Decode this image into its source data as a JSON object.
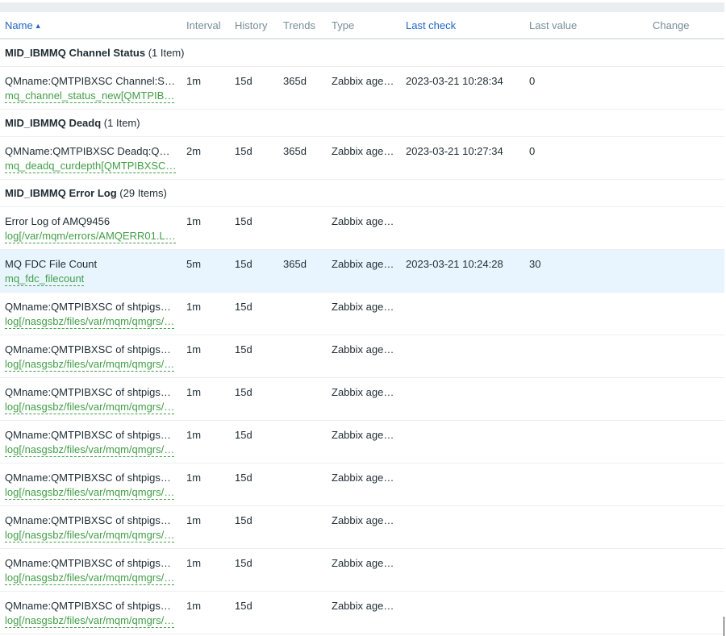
{
  "columns": {
    "name": "Name",
    "interval": "Interval",
    "history": "History",
    "trends": "Trends",
    "type": "Type",
    "last_check": "Last check",
    "last_value": "Last value",
    "change": "Change"
  },
  "sort_icon": "▲",
  "groups": [
    {
      "title": "MID_IBMMQ Channel Status",
      "count": "(1 Item)",
      "rows": [
        {
          "name": "QMname:QMTPIBXSC Channel:S…",
          "key": "mq_channel_status_new[QMTPIB…",
          "interval": "1m",
          "history": "15d",
          "trends": "365d",
          "type": "Zabbix age…",
          "last_check": "2023-03-21 10:28:34",
          "last_value": "0",
          "change": ""
        }
      ]
    },
    {
      "title": "MID_IBMMQ Deadq",
      "count": "(1 Item)",
      "rows": [
        {
          "name": "QMName:QMTPIBXSC Deadq:Q…",
          "key": "mq_deadq_curdepth[QMTPIBXSC…",
          "interval": "2m",
          "history": "15d",
          "trends": "365d",
          "type": "Zabbix age…",
          "last_check": "2023-03-21 10:27:34",
          "last_value": "0",
          "change": ""
        }
      ]
    },
    {
      "title": "MID_IBMMQ Error Log",
      "count": "(29 Items)",
      "rows": [
        {
          "name": "Error Log of AMQ9456",
          "key": "log[/var/mqm/errors/AMQERR01.L…",
          "interval": "1m",
          "history": "15d",
          "trends": "",
          "type": "Zabbix age…",
          "last_check": "",
          "last_value": "",
          "change": ""
        },
        {
          "name": "MQ FDC File Count",
          "key": "mq_fdc_filecount",
          "interval": "5m",
          "history": "15d",
          "trends": "365d",
          "type": "Zabbix age…",
          "last_check": "2023-03-21 10:24:28",
          "last_value": "30",
          "change": "",
          "highlight": true
        },
        {
          "name": "QMname:QMTPIBXSC of shtpigs…",
          "key": "log[/nasgsbz/files/var/mqm/qmgrs/…",
          "interval": "1m",
          "history": "15d",
          "trends": "",
          "type": "Zabbix age…",
          "last_check": "",
          "last_value": "",
          "change": ""
        },
        {
          "name": "QMname:QMTPIBXSC of shtpigs…",
          "key": "log[/nasgsbz/files/var/mqm/qmgrs/…",
          "interval": "1m",
          "history": "15d",
          "trends": "",
          "type": "Zabbix age…",
          "last_check": "",
          "last_value": "",
          "change": ""
        },
        {
          "name": "QMname:QMTPIBXSC of shtpigs…",
          "key": "log[/nasgsbz/files/var/mqm/qmgrs/…",
          "interval": "1m",
          "history": "15d",
          "trends": "",
          "type": "Zabbix age…",
          "last_check": "",
          "last_value": "",
          "change": ""
        },
        {
          "name": "QMname:QMTPIBXSC of shtpigs…",
          "key": "log[/nasgsbz/files/var/mqm/qmgrs/…",
          "interval": "1m",
          "history": "15d",
          "trends": "",
          "type": "Zabbix age…",
          "last_check": "",
          "last_value": "",
          "change": ""
        },
        {
          "name": "QMname:QMTPIBXSC of shtpigs…",
          "key": "log[/nasgsbz/files/var/mqm/qmgrs/…",
          "interval": "1m",
          "history": "15d",
          "trends": "",
          "type": "Zabbix age…",
          "last_check": "",
          "last_value": "",
          "change": ""
        },
        {
          "name": "QMname:QMTPIBXSC of shtpigs…",
          "key": "log[/nasgsbz/files/var/mqm/qmgrs/…",
          "interval": "1m",
          "history": "15d",
          "trends": "",
          "type": "Zabbix age…",
          "last_check": "",
          "last_value": "",
          "change": ""
        },
        {
          "name": "QMname:QMTPIBXSC of shtpigs…",
          "key": "log[/nasgsbz/files/var/mqm/qmgrs/…",
          "interval": "1m",
          "history": "15d",
          "trends": "",
          "type": "Zabbix age…",
          "last_check": "",
          "last_value": "",
          "change": ""
        },
        {
          "name": "QMname:QMTPIBXSC of shtpigs…",
          "key": "log[/nasgsbz/files/var/mqm/qmgrs/…",
          "interval": "1m",
          "history": "15d",
          "trends": "",
          "type": "Zabbix age…",
          "last_check": "",
          "last_value": "",
          "change": ""
        }
      ]
    }
  ]
}
